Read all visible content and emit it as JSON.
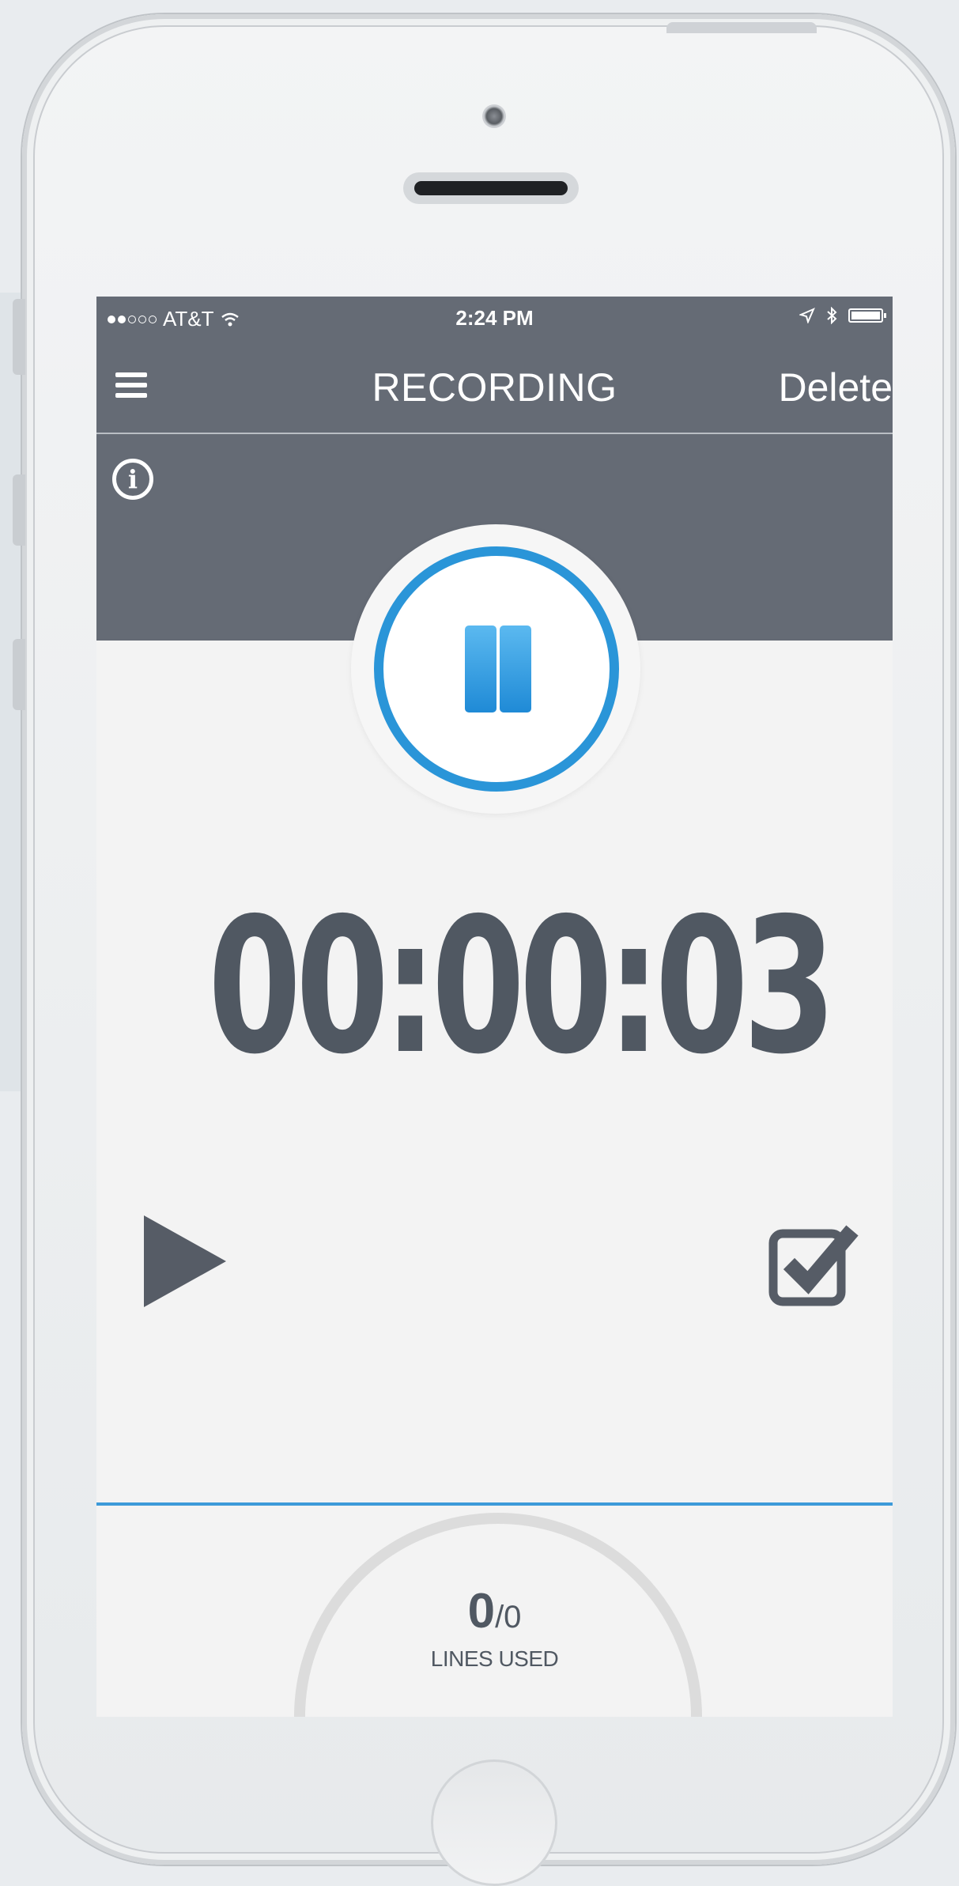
{
  "status_bar": {
    "carrier": "AT&T",
    "time": "2:24 PM"
  },
  "nav": {
    "title": "RECORDING",
    "delete_label": "Delete"
  },
  "info_icon": "info-icon",
  "recorder": {
    "state": "recording",
    "timer": "00:00:03",
    "accent_color": "#2a95d8"
  },
  "lines": {
    "used": "0",
    "total": "/0",
    "label": "LINES USED"
  },
  "colors": {
    "header_bg": "#656b75",
    "body_bg": "#f3f3f3",
    "text_dark": "#505862",
    "divider": "#3c9ad9"
  }
}
